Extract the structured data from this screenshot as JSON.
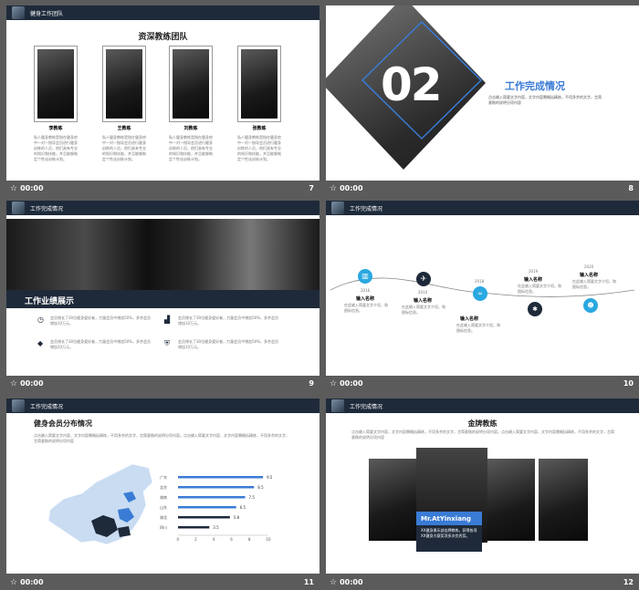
{
  "footers": {
    "time": "00:00",
    "slide7": "7",
    "slide8": "8",
    "slide9": "9",
    "slide10": "10",
    "slide11": "11",
    "slide12": "12"
  },
  "slide7": {
    "header": "健身工作团队",
    "title": "资深教练团队",
    "coaches": [
      {
        "name": "李教练"
      },
      {
        "name": "王教练"
      },
      {
        "name": "刘教练"
      },
      {
        "name": "张教练"
      }
    ],
    "desc": "私人健身教练是指在健身房中一对一指导会员进行健身训练的人员，他们具有专业的知识和技能，并且能够制定个性化训练计划。"
  },
  "slide8": {
    "number": "02",
    "title": "工作完成情况",
    "desc": "点击输入简要文字内容，文字内容需概括精炼，不用多余的文字，言简意赅的说明分项内容"
  },
  "slide9": {
    "header": "工作完成情况",
    "banner": "工作业绩展示",
    "items": [
      "会员增长了30位健身爱好者，力量会员中增加50%，多余会员增加10万元。",
      "会员增长了30位健身爱好者，力量会员中增加50%，多余会员增加10万元。",
      "会员增长了30位健身爱好者，力量会员中增加50%，多余会员增加10万元。",
      "会员增长了30位健身爱好者，力量会员中增加50%，多余会员增加10万元。"
    ]
  },
  "slide10": {
    "header": "工作完成情况",
    "timeline": [
      {
        "year": "2016",
        "label": "输入名称",
        "desc": "在此输入简要文字介绍，和图标信息。"
      },
      {
        "year": "201X",
        "label": "输入名称",
        "desc": "在此输入简要文字介绍，和图标信息。"
      },
      {
        "year": "2018",
        "label": "输入名称",
        "desc": "在此输入简要文字介绍，和图标信息。"
      },
      {
        "year": "2019",
        "label": "输入名称",
        "desc": "在此输入简要文字介绍，和图标信息。"
      },
      {
        "year": "2020",
        "label": "输入名称",
        "desc": "在此输入简要文字介绍，和图标信息。"
      }
    ]
  },
  "slide11": {
    "header": "工作完成情况",
    "title": "健身会员分布情况",
    "desc": "点击输入简要文字内容，文字内容需概括精炼，不用多余的文字，言简意赅的说明分项内容。点击输入简要文字内容，文字内容需概括精炼，不用多余的文字，言简意赅的说明分项内容"
  },
  "chart_data": {
    "type": "bar",
    "categories": [
      "广东",
      "北京",
      "湖南",
      "山东",
      "湖北",
      "四川"
    ],
    "values": [
      9.5,
      8.5,
      7.5,
      6.5,
      5.8,
      3.5
    ],
    "value_labels": [
      "9.5",
      "8.5",
      "7.5",
      "6.5",
      "5.8",
      "3.5"
    ],
    "xticks": [
      "0",
      "2",
      "4",
      "6",
      "8",
      "10"
    ],
    "xlim": [
      0,
      10
    ],
    "colors": [
      "#3a7bd5",
      "#1e2a3a"
    ]
  },
  "slide12": {
    "header": "工作完成情况",
    "title": "金牌教练",
    "desc": "点击输入简要文字内容，文字内容需概括精炼，不用多余的文字，言简意赅的说明分项内容。点击输入简要文字内容，文字内容需概括精炼，不用多余的文字，言简意赅的说明分项内容",
    "name": "Mr.AtYinxiang",
    "profile": "XX健身俱乐部金牌教练，获得各项XX健身大赛奖项多次优秀奖。"
  }
}
